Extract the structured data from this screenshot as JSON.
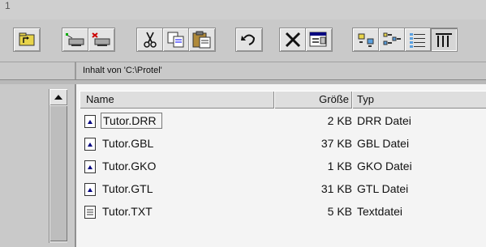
{
  "window": {
    "title_fragment": "1"
  },
  "toolbar": {
    "buttons": [
      {
        "icon": "up-folder-icon"
      },
      {
        "icon": "map-network-drive-icon"
      },
      {
        "icon": "disconnect-drive-icon"
      },
      {
        "icon": "cut-icon"
      },
      {
        "icon": "copy-icon"
      },
      {
        "icon": "paste-icon"
      },
      {
        "icon": "undo-icon"
      },
      {
        "icon": "delete-icon"
      },
      {
        "icon": "properties-icon"
      },
      {
        "icon": "large-icons-view-icon"
      },
      {
        "icon": "small-icons-view-icon"
      },
      {
        "icon": "list-view-icon"
      },
      {
        "icon": "details-view-icon"
      }
    ]
  },
  "addressbar": {
    "text": "Inhalt von 'C:\\Protel'"
  },
  "filelist": {
    "columns": {
      "name": "Name",
      "size": "Größe",
      "type": "Typ"
    },
    "rows": [
      {
        "name": "Tutor.DRR",
        "size": "2 KB",
        "type": "DRR Datei",
        "icon": "document-file-icon"
      },
      {
        "name": "Tutor.GBL",
        "size": "37 KB",
        "type": "GBL Datei",
        "icon": "document-file-icon"
      },
      {
        "name": "Tutor.GKO",
        "size": "1 KB",
        "type": "GKO Datei",
        "icon": "document-file-icon"
      },
      {
        "name": "Tutor.GTL",
        "size": "31 KB",
        "type": "GTL Datei",
        "icon": "document-file-icon"
      },
      {
        "name": "Tutor.TXT",
        "size": "5 KB",
        "type": "Textdatei",
        "icon": "text-file-icon"
      }
    ]
  },
  "colors": {
    "accent": "#000080",
    "background": "#c9c9c9",
    "list_bg": "#f4f4f4"
  }
}
